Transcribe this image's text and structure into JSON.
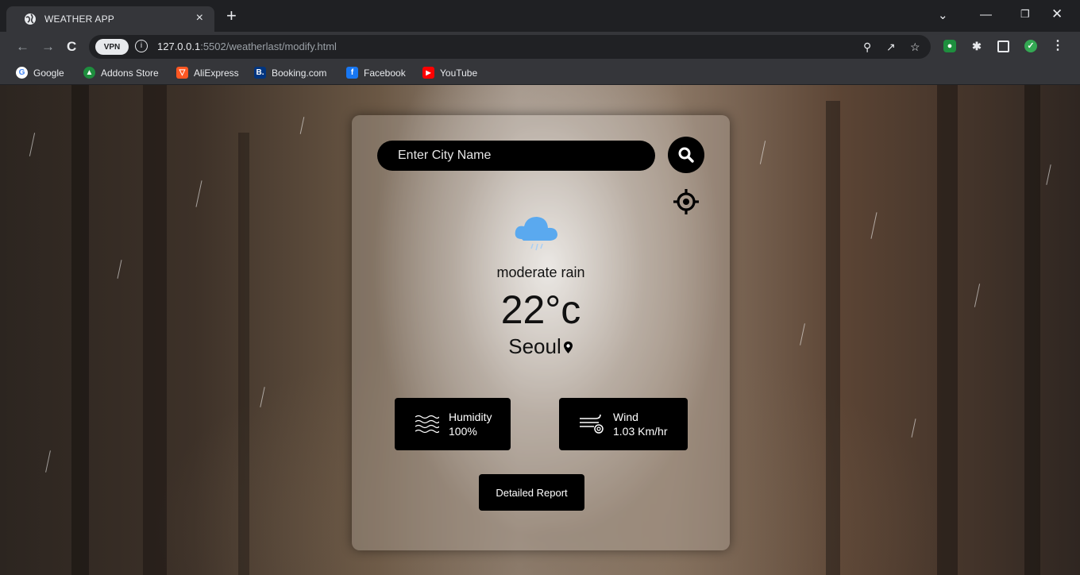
{
  "browser": {
    "tab_title": "WEATHER APP",
    "tab_close": "×",
    "new_tab": "+",
    "vpn_badge": "VPN",
    "url_host": "127.0.0.1",
    "url_rest": ":5502/weatherlast/modify.html",
    "bookmarks": [
      {
        "label": "Google",
        "icon": "google-icon",
        "color": "#ea4335"
      },
      {
        "label": "Addons Store",
        "icon": "addons-store-icon",
        "color": "#1e8e3e"
      },
      {
        "label": "AliExpress",
        "icon": "aliexpress-icon",
        "color": "#ff5722"
      },
      {
        "label": "Booking.com",
        "icon": "booking-icon",
        "color": "#003580"
      },
      {
        "label": "Facebook",
        "icon": "facebook-icon",
        "color": "#1877f2"
      },
      {
        "label": "YouTube",
        "icon": "youtube-icon",
        "color": "#ff0000"
      }
    ]
  },
  "weather": {
    "search_placeholder": "Enter City Name",
    "description": "moderate rain",
    "temperature": "22°c",
    "city": "Seoul",
    "humidity_label": "Humidity",
    "humidity_value": "100%",
    "wind_label": "Wind",
    "wind_value": "1.03 Km/hr",
    "report_button": "Detailed Report"
  },
  "colors": {
    "accent": "#000000",
    "cloud": "#5aa9ef",
    "chrome_dark": "#1f2023",
    "chrome_mid": "#35363a"
  }
}
